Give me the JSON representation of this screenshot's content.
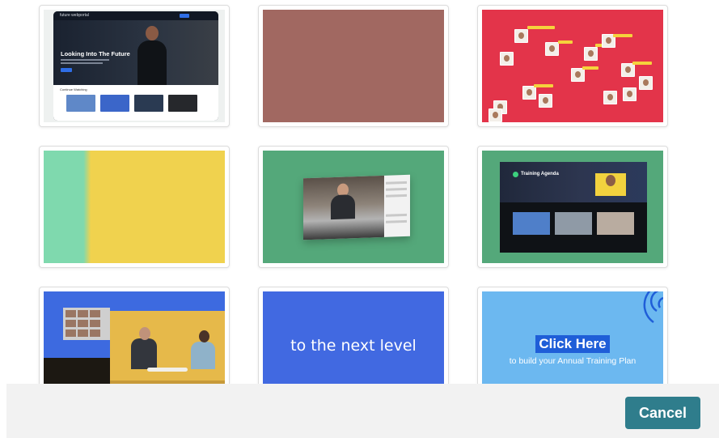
{
  "templates": [
    {
      "id": "webinar-portal",
      "brand_text": "future webportal",
      "hero_title": "Looking Into The Future",
      "section_label": "Continue Watching"
    },
    {
      "id": "plain-rose",
      "color": "#a16861"
    },
    {
      "id": "face-map",
      "color": "#e3344a"
    },
    {
      "id": "split-mint-yellow",
      "colors": [
        "#7fd9ae",
        "#f0d24e"
      ]
    },
    {
      "id": "green-window",
      "color": "#54a87a"
    },
    {
      "id": "training-agenda",
      "hero_title": "Training Agenda",
      "color": "#54a87a"
    },
    {
      "id": "podcast-studio",
      "color": "#3d6ae0"
    },
    {
      "id": "next-level",
      "caption": "to the next level",
      "color": "#4169e1"
    },
    {
      "id": "click-here",
      "headline": "Click Here",
      "subline": "to build your Annual Training Plan",
      "color": "#6cb8f0"
    }
  ],
  "footer": {
    "cancel_label": "Cancel",
    "cancel_color": "#2f7d8c"
  }
}
